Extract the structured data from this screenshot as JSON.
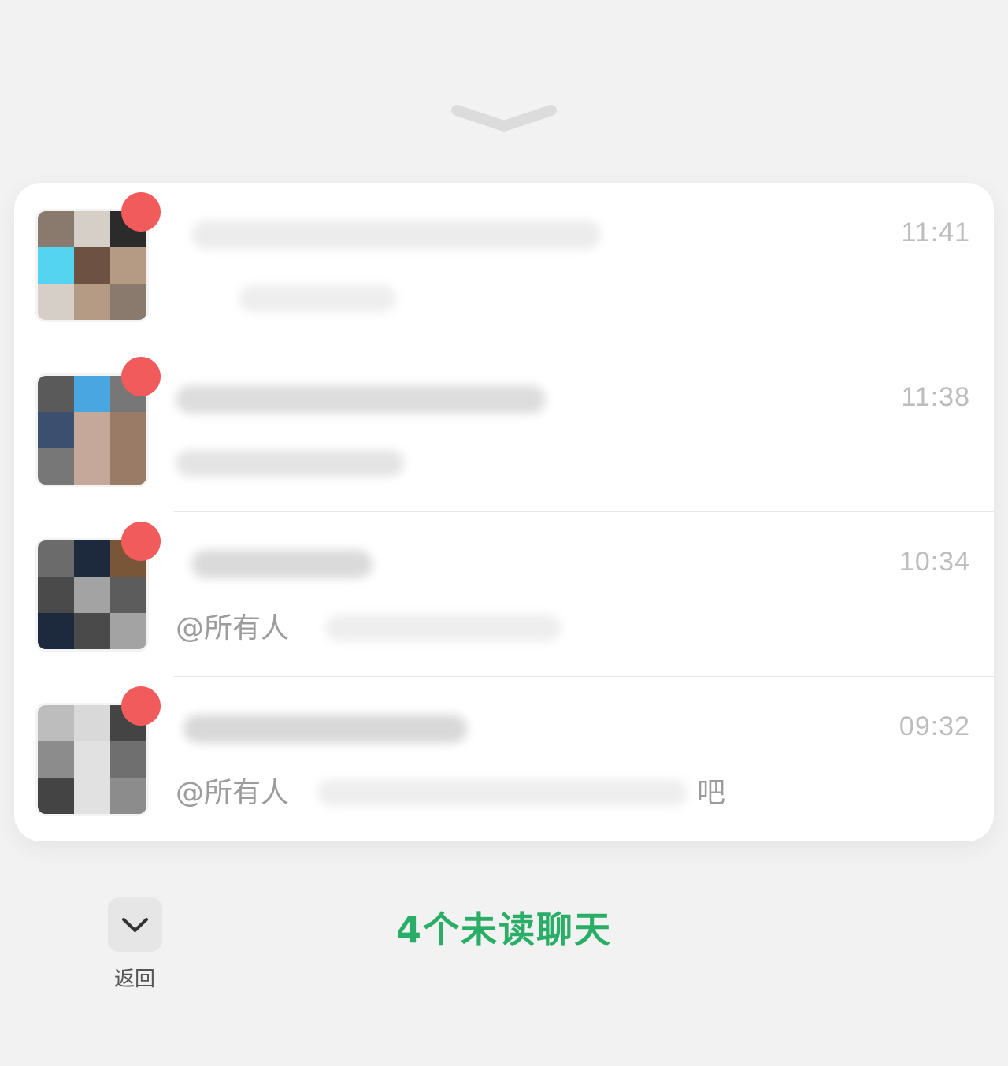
{
  "chats": [
    {
      "title": "",
      "time": "11:41",
      "preview": "",
      "avatar_colors": [
        "#8a7a6e",
        "#d6cfc7",
        "#2b2b2b",
        "#55d4f2",
        "#6d5142",
        "#b59b84"
      ]
    },
    {
      "title": "",
      "time": "11:38",
      "preview": "",
      "avatar_colors": [
        "#5a5a5a",
        "#4aa6e0",
        "#777777",
        "#3d4f6e",
        "#c5a89a",
        "#9a7b65"
      ]
    },
    {
      "title": "",
      "time": "10:34",
      "preview": "@所有人",
      "avatar_colors": [
        "#6b6b6b",
        "#1d2a3d",
        "#7a5638",
        "#4a4a4a",
        "#a3a3a3",
        "#5c5c5c"
      ]
    },
    {
      "title": "",
      "time": "09:32",
      "preview": "@所有人",
      "preview_tail": "吧",
      "avatar_colors": [
        "#bdbdbd",
        "#d9d9d9",
        "#444444",
        "#8c8c8c",
        "#e1e1e1",
        "#6f6f6f"
      ]
    }
  ],
  "unread_label": "4个未读聊天",
  "back_label": "返回",
  "icons": {
    "handle": "chevron-down-handle",
    "back": "chevron-down-icon"
  },
  "colors": {
    "accent": "#2aae67",
    "badge": "#f15b5b",
    "time": "#bdbdbd",
    "preview": "#9c9c9c"
  }
}
